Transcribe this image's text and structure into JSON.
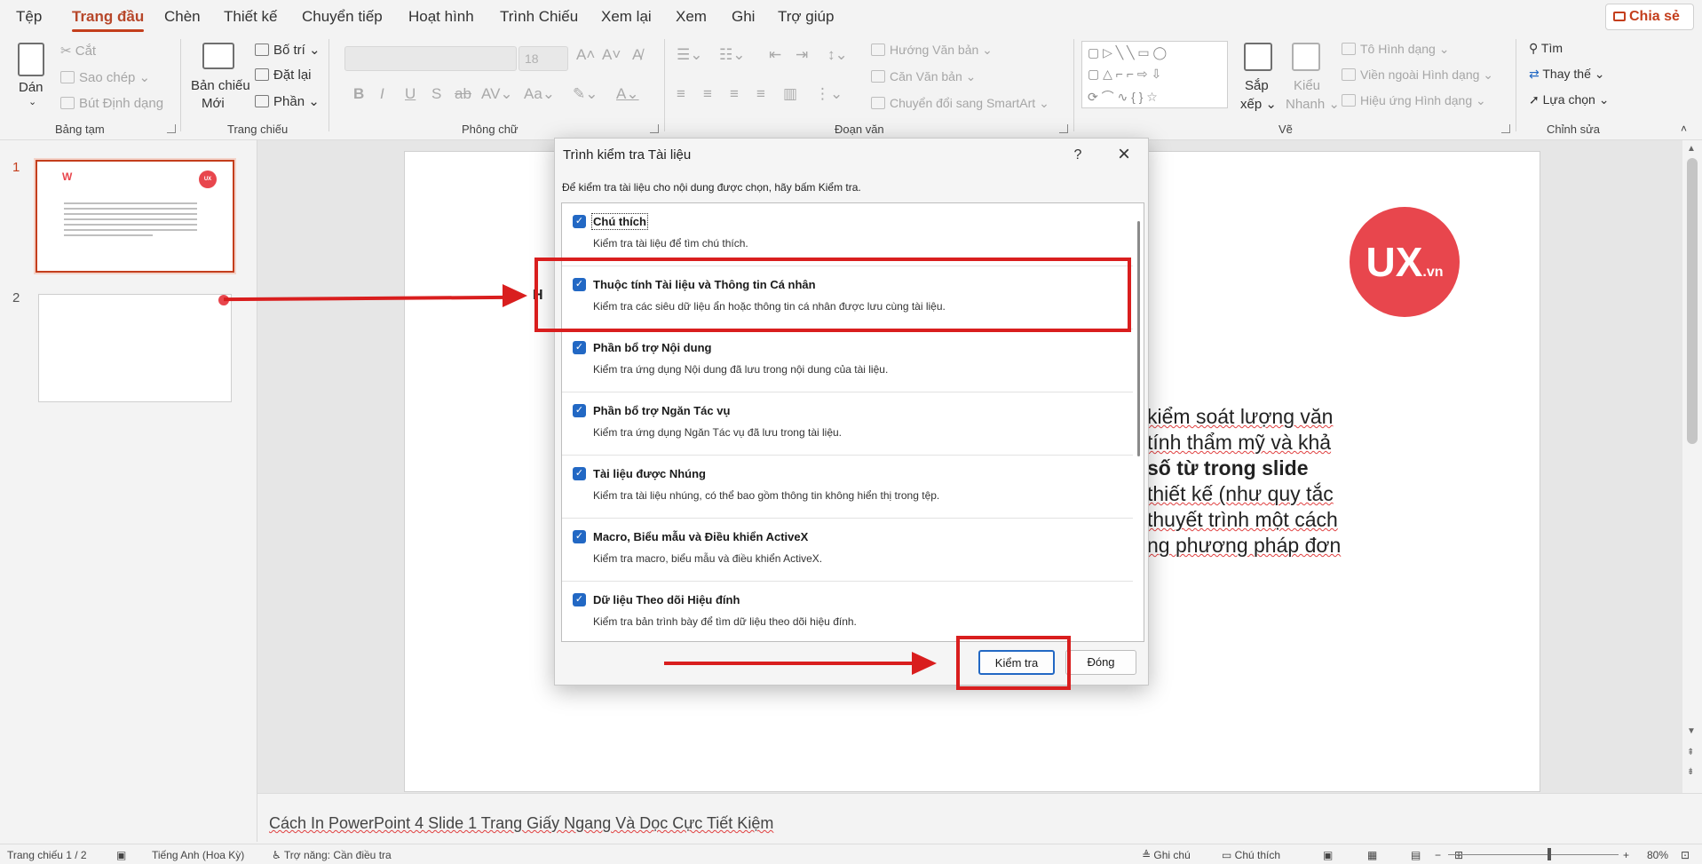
{
  "menu": {
    "tabs": [
      "Tệp",
      "Trang đầu",
      "Chèn",
      "Thiết kế",
      "Chuyển tiếp",
      "Hoạt hình",
      "Trình Chiếu",
      "Xem lại",
      "Xem",
      "Ghi",
      "Trợ giúp"
    ],
    "active_tab": "Trang đầu",
    "share": "Chia sẻ"
  },
  "ribbon": {
    "clipboard": {
      "paste": "Dán",
      "cut": "Cắt",
      "copy": "Sao chép",
      "format_painter": "Bút Định dạng",
      "label": "Bảng tạm"
    },
    "slides": {
      "new_slide_1": "Bản chiếu",
      "new_slide_2": "Mới",
      "layout": "Bố trí",
      "reset": "Đặt lại",
      "section": "Phần",
      "label": "Trang chiếu"
    },
    "font": {
      "size": "18",
      "label": "Phông chữ"
    },
    "paragraph": {
      "text_direction": "Hướng Văn bản",
      "align_text": "Căn Văn bản",
      "smartart": "Chuyển đổi sang SmartArt",
      "label": "Đoạn văn"
    },
    "drawing": {
      "arrange_1": "Sắp",
      "arrange_2": "xếp",
      "styles_1": "Kiểu",
      "styles_2": "Nhanh",
      "shape_fill": "Tô Hình dạng",
      "shape_outline": "Viền ngoài Hình dạng",
      "shape_effects": "Hiệu ứng Hình dạng",
      "label": "Vẽ"
    },
    "editing": {
      "find": "Tìm",
      "replace": "Thay thế",
      "select": "Lựa chọn",
      "label": "Chỉnh sửa"
    }
  },
  "thumbnails": {
    "numbers": [
      "1",
      "2"
    ]
  },
  "slide": {
    "logo_text": "UX",
    "logo_suffix": ".vn",
    "heading_fragment": "H",
    "lines": [
      "kiểm soát lượng văn",
      "tính thẩm mỹ và khả",
      "số từ trong slide",
      "thiết kế (như quy tắc",
      "thuyết trình một cách",
      "ng phương pháp đơn"
    ]
  },
  "notes": "Cách In PowerPoint 4 Slide 1 Trang Giấy Ngang Và Dọc Cực Tiết Kiệm",
  "status": {
    "slide_counter": "Trang chiếu 1 / 2",
    "language": "Tiếng Anh (Hoa Kỳ)",
    "accessibility": "Trợ năng: Cần điều tra",
    "notes_btn": "Ghi chú",
    "comments_btn": "Chú thích",
    "zoom": "80%"
  },
  "dialog": {
    "title": "Trình kiểm tra Tài liệu",
    "help": "?",
    "instruction": "Để kiểm tra tài liệu cho nội dung được chọn, hãy bấm Kiểm tra.",
    "items": [
      {
        "name": "Chú thích",
        "desc": "Kiểm tra tài liệu để tìm chú thích."
      },
      {
        "name": "Thuộc tính Tài liệu và Thông tin Cá nhân",
        "desc": "Kiểm tra các siêu dữ liệu ẩn hoặc thông tin cá nhân được lưu cùng tài liệu."
      },
      {
        "name": "Phần bổ trợ Nội dung",
        "desc": "Kiểm tra ứng dụng Nội dung đã lưu trong nội dung của tài liệu."
      },
      {
        "name": "Phần bổ trợ Ngăn Tác vụ",
        "desc": "Kiểm tra ứng dụng Ngăn Tác vụ đã lưu trong tài liệu."
      },
      {
        "name": "Tài liệu được Nhúng",
        "desc": "Kiểm tra tài liệu nhúng, có thể bao gồm thông tin không hiển thị trong tệp."
      },
      {
        "name": "Macro, Biểu mẫu và Điều khiển ActiveX",
        "desc": "Kiểm tra macro, biểu mẫu và điều khiển ActiveX."
      },
      {
        "name": "Dữ liệu Theo dõi Hiệu đính",
        "desc": "Kiểm tra bản trình bày để tìm dữ liệu theo dõi hiệu đính."
      }
    ],
    "inspect_button": "Kiểm tra",
    "close_button": "Đóng"
  },
  "colors": {
    "accent": "#c43e1c",
    "checkbox": "#2268c4",
    "annotation": "#d91e1e",
    "logo": "#e8464d"
  }
}
